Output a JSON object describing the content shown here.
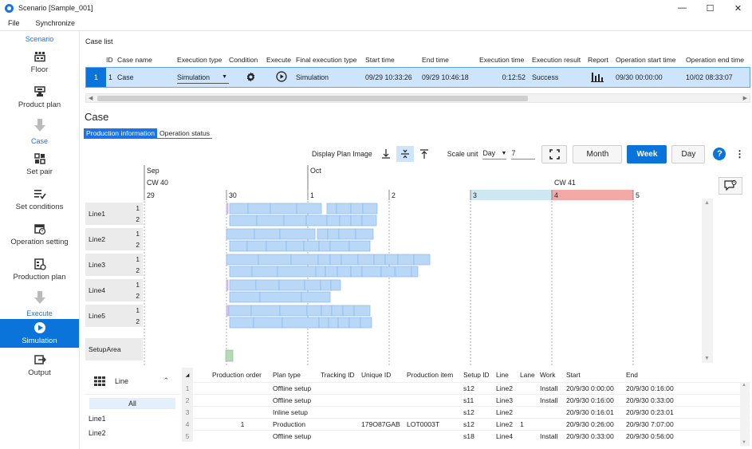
{
  "window": {
    "title": "Scenario [Sample_001]"
  },
  "menu": {
    "file": "File",
    "synchronize": "Synchronize"
  },
  "sidebar": {
    "scenario_heading": "Scenario",
    "case_heading": "Case",
    "execute_heading": "Execute",
    "items": [
      {
        "label": "Floor",
        "icon": "floor-icon"
      },
      {
        "label": "Product plan",
        "icon": "product-plan-icon"
      },
      {
        "label": "Set pair",
        "icon": "set-pair-icon"
      },
      {
        "label": "Set conditions",
        "icon": "set-conditions-icon"
      },
      {
        "label": "Operation setting",
        "icon": "operation-setting-icon"
      },
      {
        "label": "Production plan",
        "icon": "production-plan-icon"
      },
      {
        "label": "Simulation",
        "icon": "simulation-icon"
      },
      {
        "label": "Output",
        "icon": "output-icon"
      }
    ]
  },
  "case_list": {
    "title": "Case list",
    "headers": [
      "ID",
      "Case name",
      "Execution type",
      "Condition",
      "Execute",
      "Final execution type",
      "Start time",
      "End time",
      "Execution time",
      "Execution result",
      "Report",
      "Operation start time",
      "Operation end time"
    ],
    "row": {
      "index": "1",
      "id": "1",
      "name": "Case",
      "execution_type": "Simulation",
      "final_execution_type": "Simulation",
      "start_time": "09/29 10:33:26",
      "end_time": "09/29 10:46:18",
      "execution_time": "0:12:52",
      "execution_result": "Success",
      "operation_start": "09/30 00:00:00",
      "operation_end": "10/02 08:33:07"
    }
  },
  "case": {
    "title": "Case",
    "tabs": [
      "Production information",
      "Operation status"
    ]
  },
  "toolbar": {
    "display_plan_image": "Display Plan Image",
    "scale_unit": "Scale unit",
    "scale_value": "Day",
    "scale_count": "7",
    "month": "Month",
    "week": "Week",
    "day": "Day"
  },
  "gantt": {
    "months": [
      {
        "label": "Sep"
      },
      {
        "label": "Oct"
      }
    ],
    "weeks": [
      "CW 40",
      "CW 41"
    ],
    "days": [
      "29",
      "30",
      "1",
      "2",
      "3",
      "4",
      "5"
    ],
    "rows": [
      {
        "name": "Line1",
        "lanes": [
          "1",
          "2"
        ]
      },
      {
        "name": "Line2",
        "lanes": [
          "1",
          "2"
        ]
      },
      {
        "name": "Line3",
        "lanes": [
          "1",
          "2"
        ]
      },
      {
        "name": "Line4",
        "lanes": [
          "1",
          "2"
        ]
      },
      {
        "name": "Line5",
        "lanes": [
          "1",
          "2"
        ]
      },
      {
        "name": "SetupArea",
        "lanes": []
      }
    ],
    "colors": {
      "bar": "#b9d7f6",
      "bar_border": "#8ab9ea",
      "setup": "#d9c2ec",
      "highlight_blue": "#cde8f2",
      "highlight_red": "#f4a9a6",
      "setup_area": "#b6d9b6"
    }
  },
  "filter": {
    "group_label": "Line",
    "all_label": "All",
    "items": [
      "Line1",
      "Line2"
    ]
  },
  "production_table": {
    "headers": [
      "Production order",
      "Plan type",
      "Tracking ID",
      "Unique ID",
      "Production item",
      "Setup ID",
      "Line",
      "Lane",
      "Work",
      "Start",
      "End"
    ],
    "rows": [
      {
        "idx": "1",
        "order": "",
        "plan_type": "Offline setup",
        "tracking": "",
        "unique": "",
        "item": "",
        "setup": "s12",
        "line": "Line2",
        "lane": "",
        "work": "Install",
        "start": "20/9/30 0:00:00",
        "end": "20/9/30 0:16:00"
      },
      {
        "idx": "2",
        "order": "",
        "plan_type": "Offline setup",
        "tracking": "",
        "unique": "",
        "item": "",
        "setup": "s11",
        "line": "Line3",
        "lane": "",
        "work": "Install",
        "start": "20/9/30 0:16:00",
        "end": "20/9/30 0:33:00"
      },
      {
        "idx": "3",
        "order": "",
        "plan_type": "Inline setup",
        "tracking": "",
        "unique": "",
        "item": "",
        "setup": "s12",
        "line": "Line2",
        "lane": "",
        "work": "",
        "start": "20/9/30 0:16:01",
        "end": "20/9/30 0:23:01"
      },
      {
        "idx": "4",
        "order": "1",
        "plan_type": "Production",
        "tracking": "",
        "unique": "179O87GAB",
        "item": "LOT0003T",
        "setup": "s12",
        "line": "Line2",
        "lane": "1",
        "work": "",
        "start": "20/9/30 0:26:00",
        "end": "20/9/30 7:07:00"
      },
      {
        "idx": "5",
        "order": "",
        "plan_type": "Offline setup",
        "tracking": "",
        "unique": "",
        "item": "",
        "setup": "s18",
        "line": "Line4",
        "lane": "",
        "work": "Install",
        "start": "20/9/30 0:33:00",
        "end": "20/9/30 0:56:00"
      }
    ]
  }
}
